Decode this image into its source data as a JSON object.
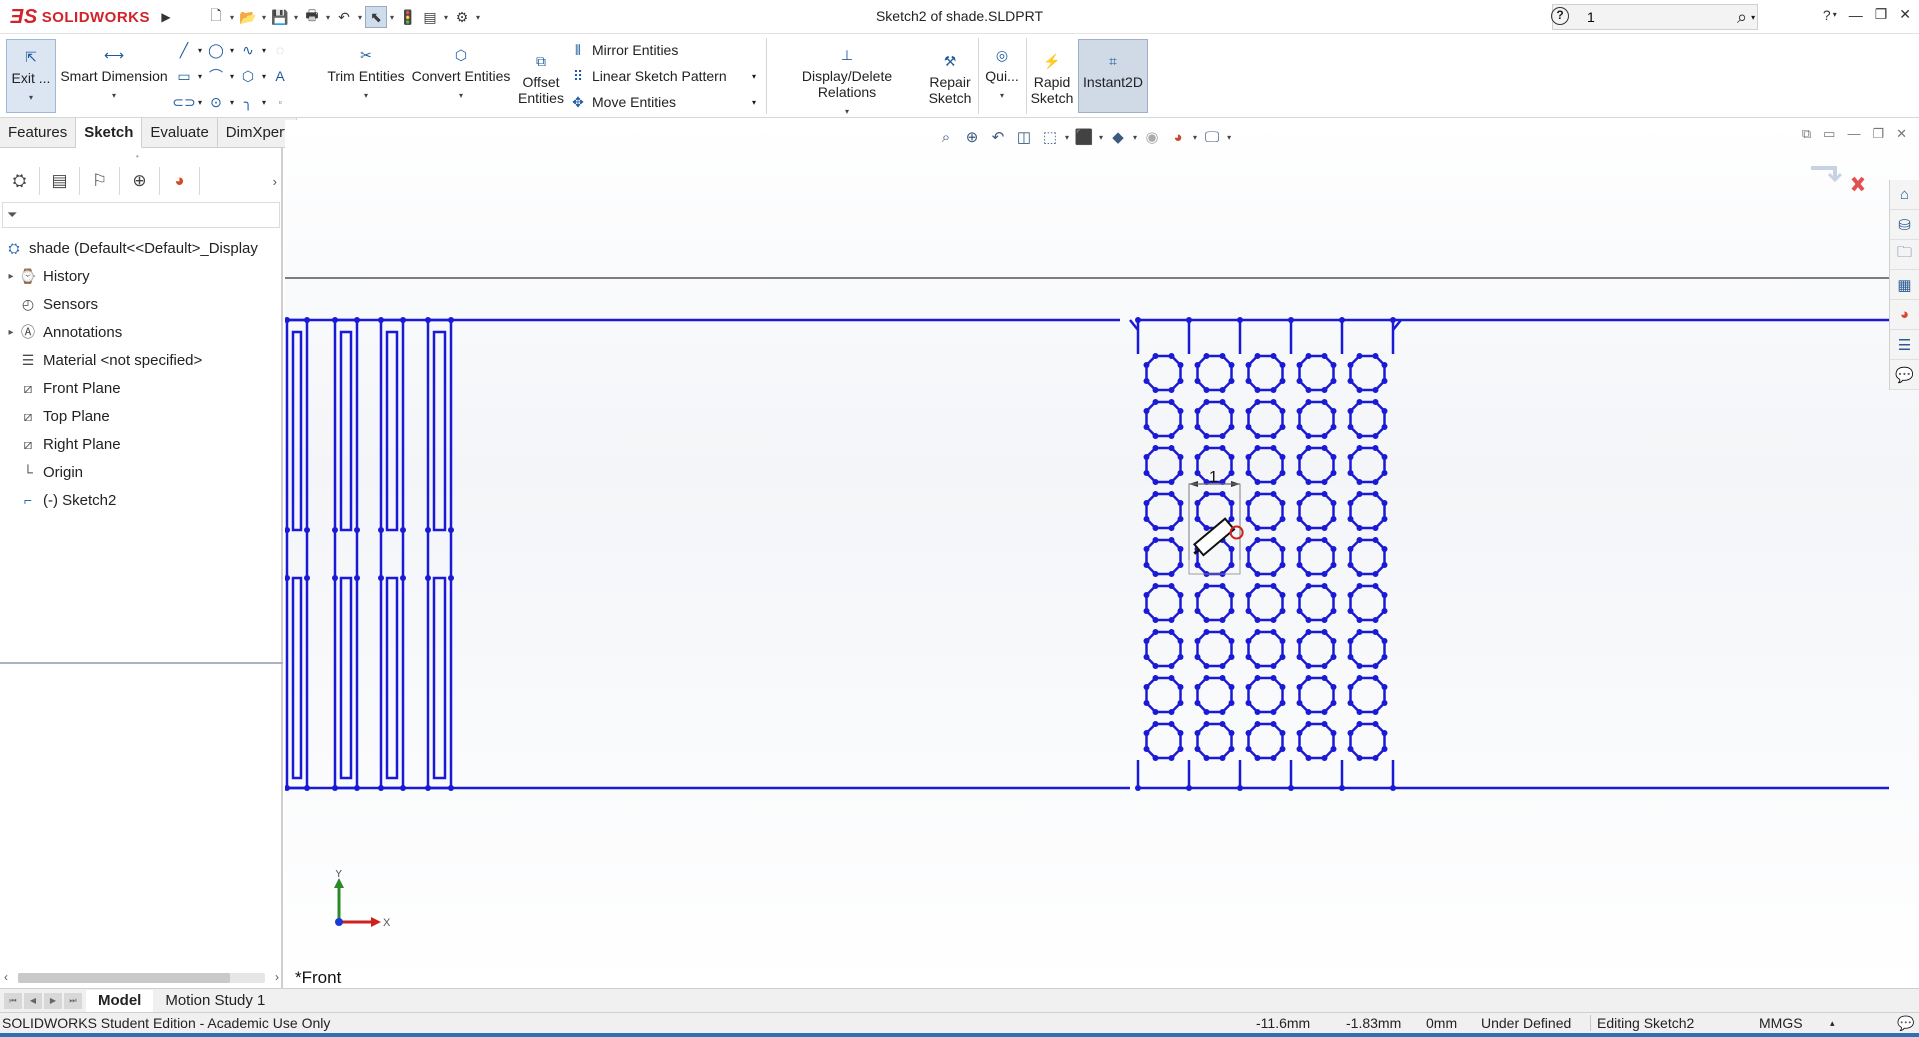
{
  "app": {
    "brand": "SOLIDWORKS",
    "document_title": "Sketch2 of shade.SLDPRT",
    "search_value": "1"
  },
  "toolbar": {
    "exit_sketch": "Exit ...",
    "smart_dimension": "Smart Dimension",
    "trim_entities": "Trim Entities",
    "convert_entities": "Convert Entities",
    "offset_entities_line1": "Offset",
    "offset_entities_line2": "Entities",
    "mirror_entities": "Mirror Entities",
    "linear_sketch_pattern": "Linear Sketch Pattern",
    "move_entities": "Move Entities",
    "display_delete_relations": "Display/Delete Relations",
    "repair_sketch_line1": "Repair",
    "repair_sketch_line2": "Sketch",
    "quick_snaps": "Qui...",
    "rapid_sketch_line1": "Rapid",
    "rapid_sketch_line2": "Sketch",
    "instant2d": "Instant2D"
  },
  "tabs": [
    {
      "label": "Features"
    },
    {
      "label": "Sketch"
    },
    {
      "label": "Evaluate"
    },
    {
      "label": "DimXpert"
    }
  ],
  "tree": {
    "root": "shade  (Default<<Default>_Display",
    "items": [
      {
        "label": "History"
      },
      {
        "label": "Sensors"
      },
      {
        "label": "Annotations"
      },
      {
        "label": "Material <not specified>"
      },
      {
        "label": "Front Plane"
      },
      {
        "label": "Top Plane"
      },
      {
        "label": "Right Plane"
      },
      {
        "label": "Origin"
      },
      {
        "label": "(-) Sketch2"
      }
    ]
  },
  "viewport": {
    "view_label": "*Front",
    "dimension_label": "1",
    "axis_x": "X",
    "axis_y": "Y"
  },
  "bottom_tabs": [
    {
      "label": "Model"
    },
    {
      "label": "Motion Study 1"
    }
  ],
  "status": {
    "edition": "SOLIDWORKS Student Edition - Academic Use Only",
    "x_coord": "-11.6mm",
    "y_coord": "-1.83mm",
    "z_coord": "0mm",
    "definition": "Under Defined",
    "editing": "Editing Sketch2",
    "units": "MMGS"
  },
  "colors": {
    "sketch_blue": "#1a1ad6",
    "brand_red": "#d2232a"
  }
}
